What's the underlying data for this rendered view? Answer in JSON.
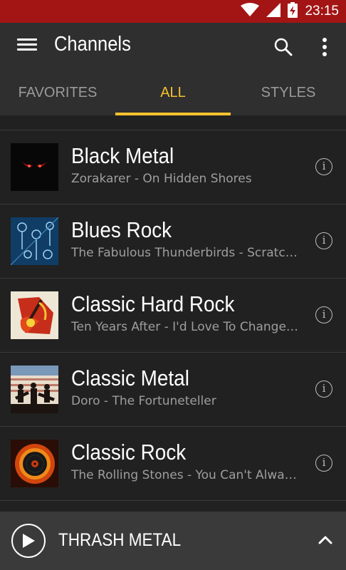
{
  "status_bar": {
    "time": "23:15",
    "icons": [
      "wifi-icon",
      "signal-icon",
      "battery-charging-icon"
    ]
  },
  "app_bar": {
    "title": "Channels",
    "icons": [
      "menu-icon",
      "search-icon",
      "more-vert-icon"
    ]
  },
  "tabs": [
    {
      "label": "FAVORITES",
      "active": false
    },
    {
      "label": "ALL",
      "active": true
    },
    {
      "label": "STYLES",
      "active": false
    }
  ],
  "channels": [
    {
      "title": "Black Metal",
      "subtitle": "Zorakarer - On Hidden Shores"
    },
    {
      "title": "Blues Rock",
      "subtitle": "The Fabulous Thunderbirds - Scratch..."
    },
    {
      "title": "Classic Hard Rock",
      "subtitle": "Ten Years After - I'd Love To Change T..."
    },
    {
      "title": "Classic Metal",
      "subtitle": "Doro - The Fortuneteller"
    },
    {
      "title": "Classic Rock",
      "subtitle": "The Rolling Stones - You Can't Alway..."
    }
  ],
  "info_glyph": "i",
  "player": {
    "title": "THRASH METAL",
    "icons": [
      "play-icon",
      "chevron-up-icon"
    ]
  },
  "colors": {
    "status_bar": "#a31515",
    "app_bar": "#2f2f2f",
    "accent": "#f6c12f",
    "background": "#212121",
    "player": "#3a3a3a"
  }
}
